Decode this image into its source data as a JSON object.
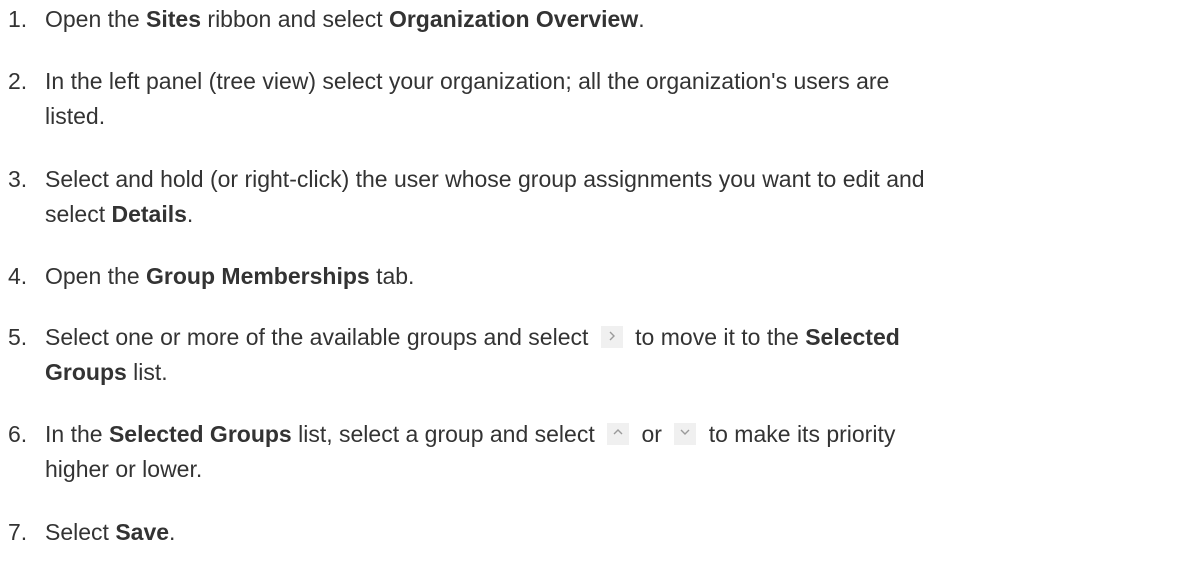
{
  "steps": [
    {
      "number": "1.",
      "p1": "Open the ",
      "b1": "Sites",
      "p2": " ribbon and select ",
      "b2": "Organization Overview",
      "p3": "."
    },
    {
      "number": "2.",
      "line1": "In the left panel (tree view) select your organization; all the organization's users are",
      "line2": "listed."
    },
    {
      "number": "3.",
      "line1": "Select and hold (or right-click) the user whose group assignments you want to edit and",
      "p1": "select ",
      "b1": "Details",
      "p2": "."
    },
    {
      "number": "4.",
      "p1": "Open the ",
      "b1": "Group Memberships",
      "p2": " tab."
    },
    {
      "number": "5.",
      "p1": "Select one or more of the available groups and select ",
      "icon": "chevron-right-icon",
      "p2": " to move it to the ",
      "b1": "Selected",
      "b2": "Groups",
      "p3": " list."
    },
    {
      "number": "6.",
      "p1": "In the ",
      "b1": "Selected Groups",
      "p2": " list, select a group and select ",
      "icon1": "chevron-up-icon",
      "p3": " or ",
      "icon2": "chevron-down-icon",
      "p4": " to make its priority",
      "line2": "higher or lower."
    },
    {
      "number": "7.",
      "p1": "Select ",
      "b1": "Save",
      "p2": "."
    }
  ],
  "colors": {
    "text": "#333333",
    "icon_bg": "#f0f0f0",
    "icon_fg": "#9a9a9a"
  }
}
